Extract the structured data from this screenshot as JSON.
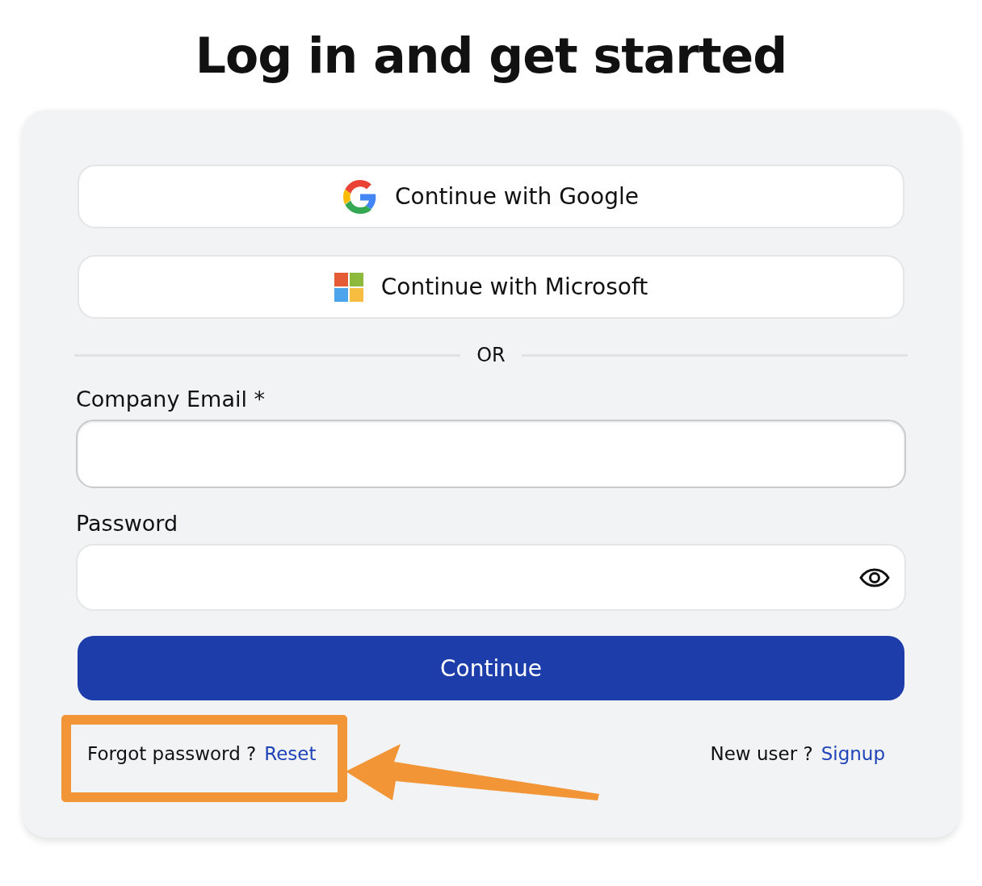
{
  "title": "Log in and get started",
  "social_buttons": [
    {
      "kind": "google",
      "label": "Continue with Google"
    },
    {
      "kind": "microsoft",
      "label": "Continue with Microsoft"
    }
  ],
  "divider": "OR",
  "fields": [
    {
      "kind": "email",
      "label": "Company Email *"
    },
    {
      "kind": "password",
      "label": "Password"
    }
  ],
  "submit": "Continue",
  "forgot": {
    "text": "Forgot password ?",
    "link": "Reset",
    "highlighted": true
  },
  "signup": {
    "text": "New user ?",
    "link": "Signup"
  }
}
